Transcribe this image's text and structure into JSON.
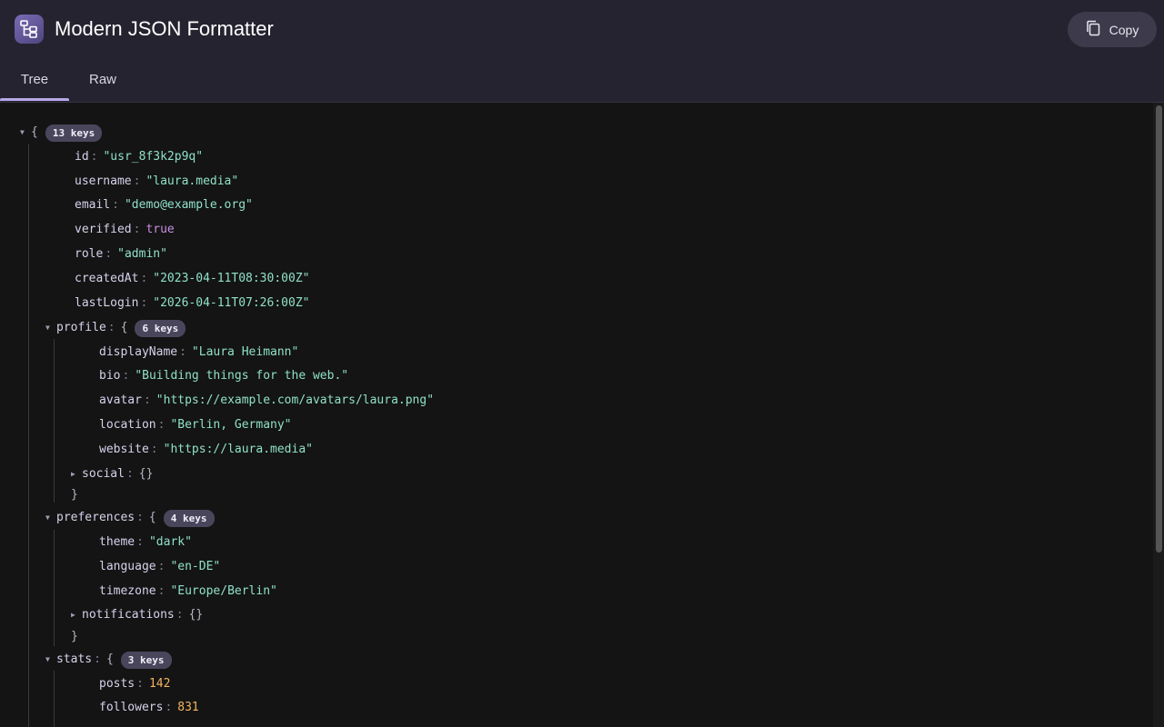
{
  "app": {
    "title": "Modern JSON Formatter",
    "icon": "tree-structure-icon"
  },
  "toolbar": {
    "copy_label": "Copy",
    "copy_icon": "copy-icon"
  },
  "tabs": [
    {
      "label": "Tree",
      "active": true
    },
    {
      "label": "Raw",
      "active": false
    }
  ],
  "tree": {
    "root": {
      "open": "{",
      "badge": "13 keys"
    },
    "fields": [
      {
        "key": "id",
        "value": "\"usr_8f3k2p9q\"",
        "type": "string"
      },
      {
        "key": "username",
        "value": "\"laura.media\"",
        "type": "string"
      },
      {
        "key": "email",
        "value": "\"demo@example.org\"",
        "type": "string"
      },
      {
        "key": "verified",
        "value": "true",
        "type": "boolean"
      },
      {
        "key": "role",
        "value": "\"admin\"",
        "type": "string"
      },
      {
        "key": "createdAt",
        "value": "\"2023-04-11T08:30:00Z\"",
        "type": "string"
      },
      {
        "key": "lastLogin",
        "value": "\"2026-04-11T07:26:00Z\"",
        "type": "string"
      }
    ],
    "profile": {
      "key": "profile",
      "open": "{",
      "badge": "6 keys",
      "close": "}",
      "fields": [
        {
          "key": "displayName",
          "value": "\"Laura Heimann\""
        },
        {
          "key": "bio",
          "value": "\"Building things for the web.\""
        },
        {
          "key": "avatar",
          "value": "\"https://example.com/avatars/laura.png\""
        },
        {
          "key": "location",
          "value": "\"Berlin, Germany\""
        },
        {
          "key": "website",
          "value": "\"https://laura.media\""
        }
      ],
      "collapsed": {
        "key": "social",
        "value": "{}"
      }
    },
    "preferences": {
      "key": "preferences",
      "open": "{",
      "badge": "4 keys",
      "close": "}",
      "fields": [
        {
          "key": "theme",
          "value": "\"dark\""
        },
        {
          "key": "language",
          "value": "\"en-DE\""
        },
        {
          "key": "timezone",
          "value": "\"Europe/Berlin\""
        }
      ],
      "collapsed": {
        "key": "notifications",
        "value": "{}"
      }
    },
    "stats": {
      "key": "stats",
      "open": "{",
      "badge": "3 keys",
      "fields": [
        {
          "key": "posts",
          "value": "142"
        },
        {
          "key": "followers",
          "value": "831"
        }
      ]
    }
  }
}
